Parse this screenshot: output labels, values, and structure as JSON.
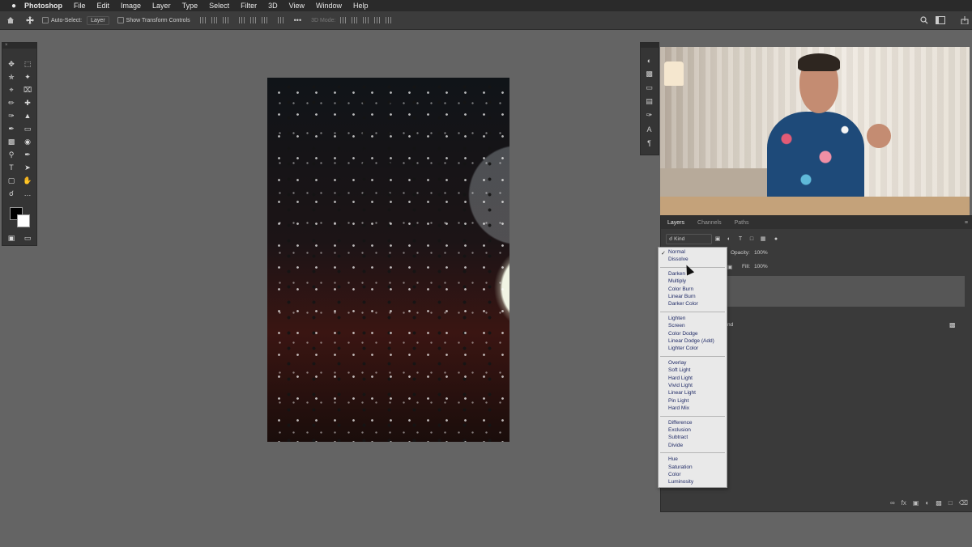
{
  "menubar": {
    "apple": "",
    "app": "Photoshop",
    "items": [
      "File",
      "Edit",
      "Image",
      "Layer",
      "Type",
      "Select",
      "Filter",
      "3D",
      "View",
      "Window",
      "Help"
    ]
  },
  "options": {
    "auto_select": "Auto-Select:",
    "layer": "Layer",
    "show_transform": "Show Transform Controls",
    "mode_3d": "3D Mode:"
  },
  "layers_panel": {
    "tabs": [
      "Layers",
      "Channels",
      "Paths"
    ],
    "kind": "Kind",
    "opacity_label": "Opacity:",
    "opacity_value": "100%",
    "fill_label": "Fill:",
    "fill_value": "100%",
    "bg_partial": "nd"
  },
  "blend_menu": {
    "groups": [
      [
        "Normal",
        "Dissolve"
      ],
      [
        "Darken",
        "Multiply",
        "Color Burn",
        "Linear Burn",
        "Darker Color"
      ],
      [
        "Lighten",
        "Screen",
        "Color Dodge",
        "Linear Dodge (Add)",
        "Lighter Color"
      ],
      [
        "Overlay",
        "Soft Light",
        "Hard Light",
        "Vivid Light",
        "Linear Light",
        "Pin Light",
        "Hard Mix"
      ],
      [
        "Difference",
        "Exclusion",
        "Subtract",
        "Divide"
      ],
      [
        "Hue",
        "Saturation",
        "Color",
        "Luminosity"
      ]
    ],
    "selected": "Normal"
  },
  "colors": {
    "menubar": "#2a2a2a",
    "workspace": "#646464",
    "panel": "#3a3a3a",
    "menu_bg": "#e9e9e9",
    "menu_text": "#1f2a66"
  },
  "icons": [
    "apple-icon",
    "home-icon",
    "move-icon",
    "search-icon",
    "workspace-icon",
    "share-icon"
  ]
}
